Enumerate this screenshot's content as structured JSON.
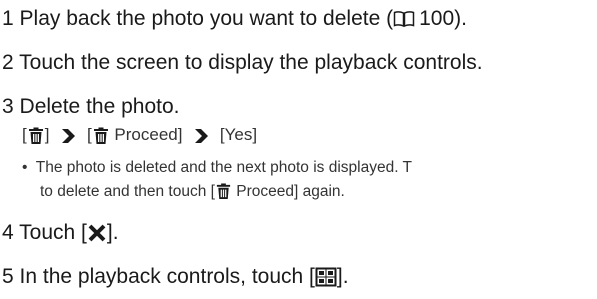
{
  "steps": [
    {
      "number": "1",
      "text_before": "Play back the photo you want to delete (",
      "ref_page": "100",
      "text_after": ")."
    },
    {
      "number": "2",
      "text": "Touch the screen to display the playback controls."
    },
    {
      "number": "3",
      "text": "Delete the photo.",
      "sequence": {
        "open1": "[",
        "close1": "]",
        "open2": "[",
        "proceed_label": "Proceed]",
        "yes_label": "[Yes]"
      },
      "bullet": {
        "symbol": "•",
        "line1": "The photo is deleted and the next photo is displayed. T",
        "line2_before": "to delete and then touch [",
        "line2_after": "Proceed] again."
      }
    },
    {
      "number": "4",
      "text_before": "Touch [",
      "text_after": "]."
    },
    {
      "number": "5",
      "text_before": "In the playback controls, touch [",
      "text_after": "]."
    }
  ],
  "icons": {
    "book": "book-icon",
    "trash": "trash-icon",
    "arrow": "arrow-right-icon",
    "close": "close-icon",
    "index": "index-icon"
  }
}
